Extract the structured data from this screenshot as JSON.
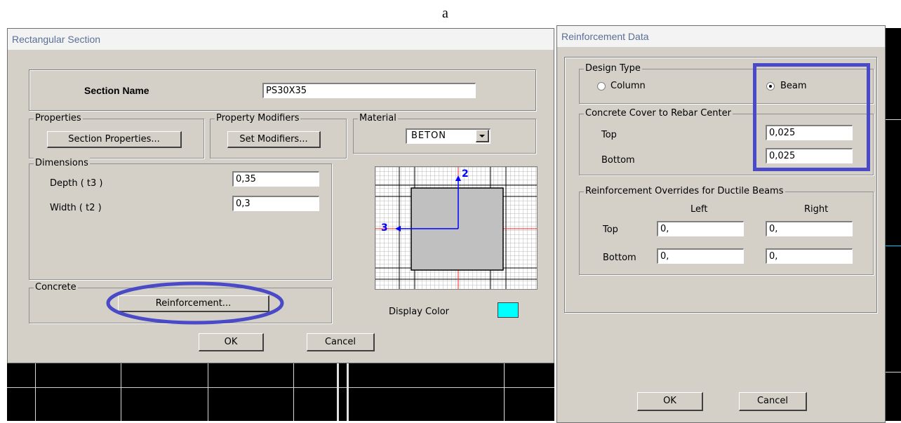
{
  "figure_label": "a",
  "rect_section": {
    "title": "Rectangular Section",
    "section_name_label": "Section Name",
    "section_name_value": "PS30X35",
    "properties": {
      "group": "Properties",
      "button": "Section Properties..."
    },
    "modifiers": {
      "group": "Property Modifiers",
      "button": "Set Modifiers..."
    },
    "material": {
      "group": "Material",
      "value": "BETON"
    },
    "dimensions": {
      "group": "Dimensions",
      "depth_label": "Depth  ( t3 )",
      "depth_value": "0,35",
      "width_label": "Width  ( t2 )",
      "width_value": "0,3"
    },
    "preview": {
      "axis2": "2",
      "axis3": "3"
    },
    "concrete": {
      "group": "Concrete",
      "button": "Reinforcement..."
    },
    "display_color_label": "Display Color",
    "display_color": "#00ffff",
    "ok": "OK",
    "cancel": "Cancel"
  },
  "reinforcement": {
    "title": "Reinforcement Data",
    "design_type": {
      "group": "Design Type",
      "column": "Column",
      "beam": "Beam",
      "selected": "beam"
    },
    "cover": {
      "group": "Concrete Cover to Rebar Center",
      "top_label": "Top",
      "top_value": "0,025",
      "bottom_label": "Bottom",
      "bottom_value": "0,025"
    },
    "overrides": {
      "group": "Reinforcement Overrides for Ductile Beams",
      "left_header": "Left",
      "right_header": "Right",
      "top_label": "Top",
      "bottom_label": "Bottom",
      "top_left": "0,",
      "top_right": "0,",
      "bottom_left": "0,",
      "bottom_right": "0,"
    },
    "ok": "OK",
    "cancel": "Cancel"
  },
  "highlight_color": "#4a4ac8"
}
